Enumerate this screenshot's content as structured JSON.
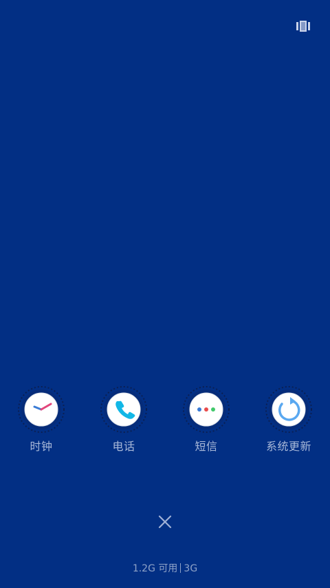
{
  "top_bar": {
    "layout_icon": "multi-window-icon"
  },
  "apps": [
    {
      "label": "时钟",
      "icon": "clock-icon"
    },
    {
      "label": "电话",
      "icon": "phone-icon"
    },
    {
      "label": "短信",
      "icon": "message-icon"
    },
    {
      "label": "系统更新",
      "icon": "update-icon"
    }
  ],
  "footer": {
    "close_icon": "close-icon",
    "memory_available": "1.2G 可用",
    "memory_total": "3G"
  },
  "colors": {
    "background": "#022f84",
    "label": "#a8b8d8"
  }
}
